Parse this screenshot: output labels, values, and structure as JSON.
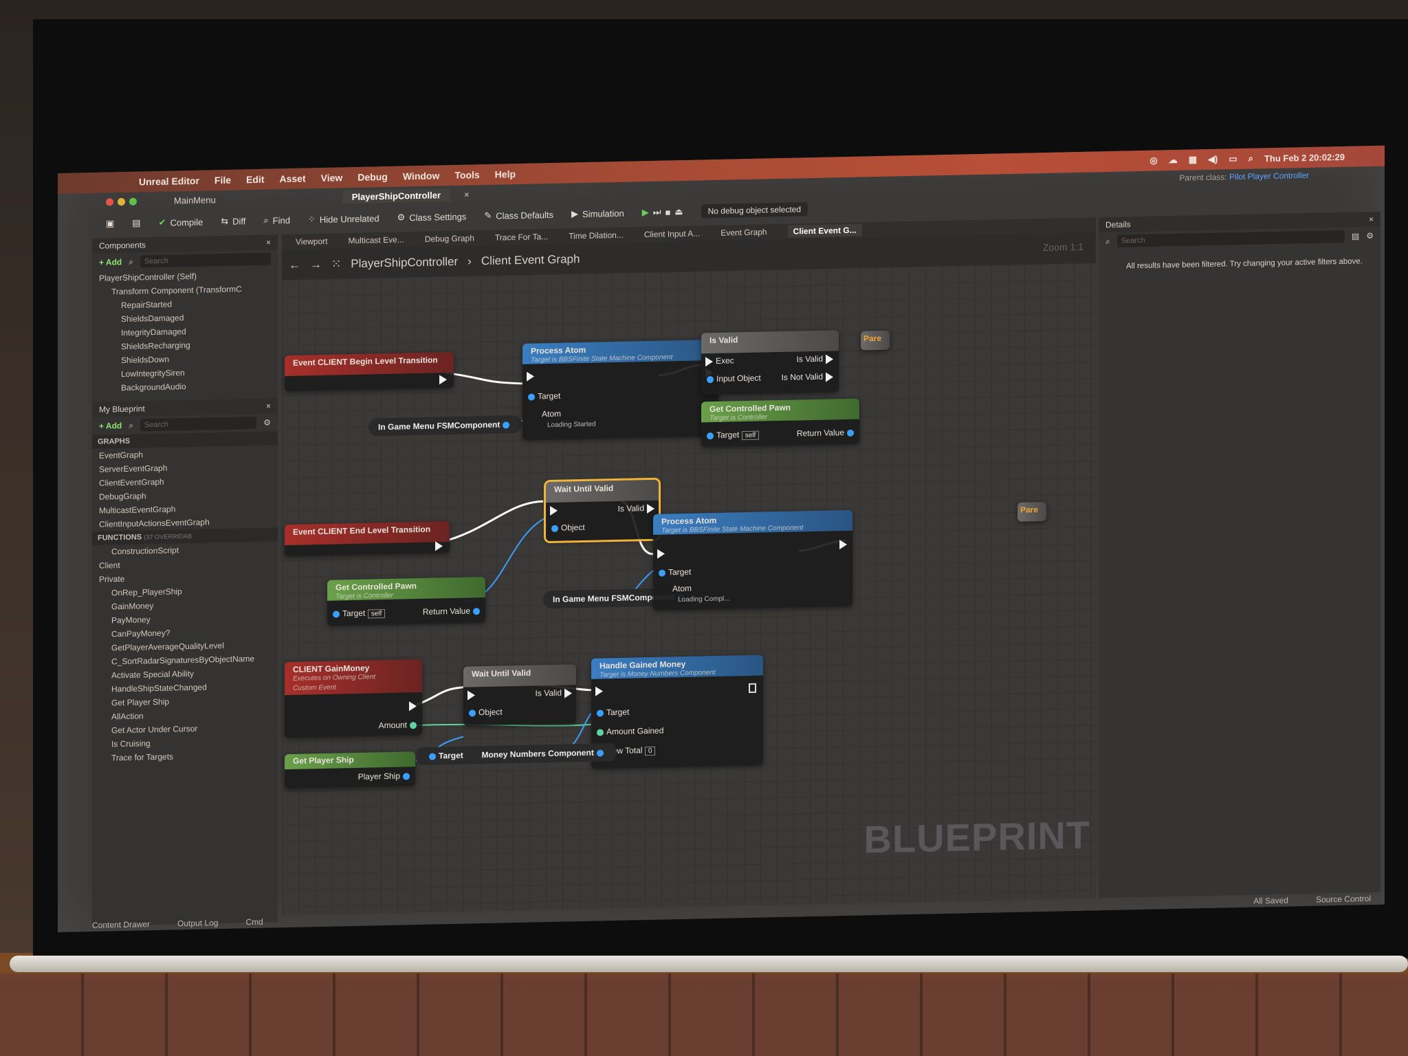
{
  "menubar": {
    "app": "Unreal Editor",
    "items": [
      "File",
      "Edit",
      "Asset",
      "View",
      "Debug",
      "Window",
      "Tools",
      "Help"
    ],
    "clock": "Thu Feb 2  20:02:29"
  },
  "tabs": {
    "main": "MainMenu",
    "asset": "PlayerShipController"
  },
  "parent_class": {
    "label": "Parent class:",
    "value": "Pilot Player Controller"
  },
  "toolbar": {
    "compile": "Compile",
    "diff": "Diff",
    "find": "Find",
    "hide_unrelated": "Hide Unrelated",
    "class_settings": "Class Settings",
    "class_defaults": "Class Defaults",
    "simulation": "Simulation",
    "debug_object": "No debug object selected"
  },
  "components_panel": {
    "title": "Components",
    "add": "+ Add",
    "search_placeholder": "Search",
    "items": [
      "PlayerShipController (Self)",
      "Transform Component (TransformC",
      "RepairStarted",
      "ShieldsDamaged",
      "IntegrityDamaged",
      "ShieldsRecharging",
      "ShieldsDown",
      "LowIntegritySiren",
      "BackgroundAudio"
    ]
  },
  "my_blueprint": {
    "title": "My Blueprint",
    "add": "+ Add",
    "search_placeholder": "Search",
    "graphs_header": "GRAPHS",
    "graphs": [
      "EventGraph",
      "ServerEventGraph",
      "ClientEventGraph",
      "DebugGraph",
      "MulticastEventGraph",
      "ClientInputActionsEventGraph"
    ],
    "functions_header": "FUNCTIONS",
    "functions_count": "(37 OVERRIDAB",
    "functions": [
      "ConstructionScript",
      "Client",
      "Private",
      "OnRep_PlayerShip",
      "GainMoney",
      "PayMoney",
      "CanPayMoney?",
      "GetPlayerAverageQualityLevel",
      "C_SortRadarSignaturesByObjectName",
      "Activate Special Ability",
      "HandleShipStateChanged",
      "Get Player Ship",
      "AllAction",
      "Get Actor Under Cursor",
      "Is Cruising",
      "Trace for Targets"
    ]
  },
  "graph_tabs": [
    "Viewport",
    "Multicast Eve...",
    "Debug Graph",
    "Trace For Ta...",
    "Time Dilation...",
    "Client Input A...",
    "Event Graph",
    "Client Event G..."
  ],
  "breadcrumb": {
    "root": "PlayerShipController",
    "current": "Client Event Graph"
  },
  "zoom": "Zoom 1:1",
  "details": {
    "title": "Details",
    "search_placeholder": "Search",
    "message": "All results have been filtered. Try changing your active filters above."
  },
  "nodes": {
    "begin_event": "Event CLIENT Begin Level Transition",
    "end_event": "Event CLIENT End Level Transition",
    "process_atom_1": {
      "title": "Process Atom",
      "sub": "Target is BBSFinite State Machine Component",
      "target": "Target",
      "atom": "Atom",
      "atom_value": "Loading Started"
    },
    "process_atom_2": {
      "title": "Process Atom",
      "sub": "Target is BBSFinite State Machine Component",
      "target": "Target",
      "atom": "Atom",
      "atom_value": "Loading Compl..."
    },
    "fsm_var_1": "In Game Menu FSMComponent",
    "fsm_var_2": "In Game Menu FSMComponent",
    "is_valid": {
      "title": "Is Valid",
      "exec": "Exec",
      "input": "Input Object",
      "valid": "Is Valid",
      "not_valid": "Is Not Valid"
    },
    "get_pawn_1": {
      "title": "Get Controlled Pawn",
      "sub": "Target is Controller",
      "target": "Target",
      "self": "self",
      "ret": "Return Value"
    },
    "get_pawn_2": {
      "title": "Get Controlled Pawn",
      "sub": "Target is Controller",
      "target": "Target",
      "self": "self",
      "ret": "Return Value"
    },
    "wait_valid_1": {
      "title": "Wait Until Valid",
      "valid": "Is Valid",
      "object": "Object"
    },
    "wait_valid_2": {
      "title": "Wait Until Valid",
      "valid": "Is Valid",
      "object": "Object"
    },
    "gain_money": {
      "title": "CLIENT GainMoney",
      "sub1": "Executes on Owning Client",
      "sub2": "Custom Event",
      "amount": "Amount"
    },
    "handle_money": {
      "title": "Handle Gained Money",
      "sub": "Target is Money Numbers Component",
      "target": "Target",
      "gained": "Amount Gained",
      "total": "New Total",
      "total_value": "0"
    },
    "get_player_ship": {
      "title": "Get Player Ship",
      "out": "Player Ship"
    },
    "money_comp": {
      "target": "Target",
      "out": "Money Numbers Component"
    },
    "parent_1": "Pare",
    "parent_2": "Pare"
  },
  "watermark": "BLUEPRINT",
  "statusbar": {
    "content_drawer": "Content Drawer",
    "output_log": "Output Log",
    "cmd": "Cmd",
    "saved": "All Saved",
    "source": "Source Control"
  },
  "colors": {
    "menubar": "#b84f37",
    "event_red": "#a62f2a",
    "function_blue": "#3a7ec1",
    "pure_green": "#6aa04a",
    "selected": "#f0b43a"
  }
}
